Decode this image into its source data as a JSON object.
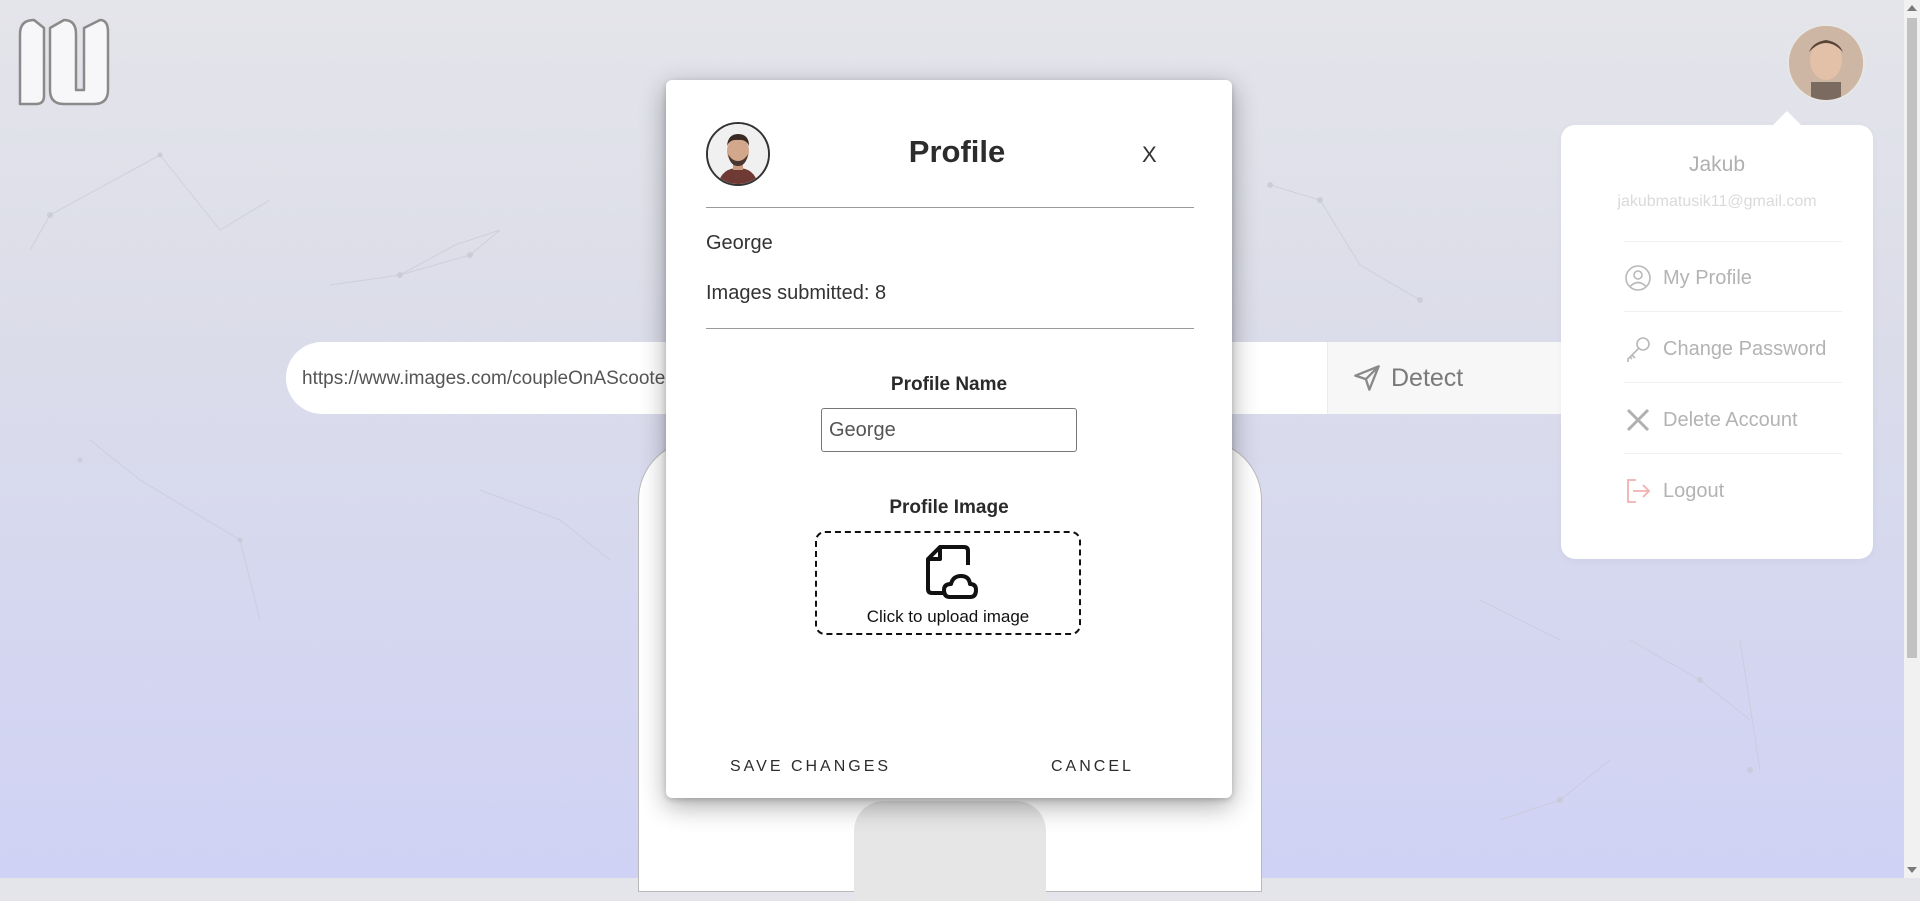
{
  "search": {
    "value": "https://www.images.com/coupleOnAScooter.jpg",
    "detect_label": "Detect"
  },
  "user_menu": {
    "name": "Jakub",
    "email": "jakubmatusik11@gmail.com",
    "items": [
      {
        "label": "My Profile",
        "icon": "user-circle-icon"
      },
      {
        "label": "Change Password",
        "icon": "key-icon"
      },
      {
        "label": "Delete Account",
        "icon": "x-icon"
      },
      {
        "label": "Logout",
        "icon": "logout-icon"
      }
    ]
  },
  "modal": {
    "title": "Profile",
    "close_label": "X",
    "username": "George",
    "images_submitted": "Images submitted: 8",
    "name_label": "Profile Name",
    "name_value": "George",
    "image_label": "Profile Image",
    "upload_text": "Click to upload image",
    "save_label": "SAVE CHANGES",
    "cancel_label": "CANCEL"
  },
  "colors": {
    "background_top": "#e4e5ea",
    "background_bottom": "#cfd2f4",
    "logout_accent": "#f2b0b0",
    "text_dark": "#2c2c2c"
  }
}
